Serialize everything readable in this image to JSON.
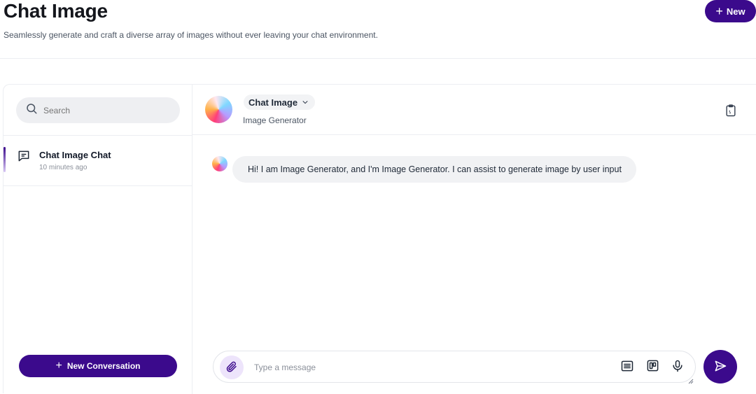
{
  "header": {
    "title": "Chat Image",
    "subtitle": "Seamlessly generate and craft a diverse array of images without ever leaving your chat environment.",
    "new_button": "New"
  },
  "sidebar": {
    "search_placeholder": "Search",
    "conversations": [
      {
        "title": "Chat Image Chat",
        "time": "10 minutes ago"
      }
    ],
    "new_conversation_button": "New Conversation"
  },
  "chat": {
    "model_name": "Chat Image",
    "model_subtitle": "Image Generator",
    "messages": [
      {
        "role": "bot",
        "text": "Hi! I am Image Generator, and I'm Image Generator. I can assist to generate image by user input"
      }
    ],
    "input_placeholder": "Type a message"
  },
  "colors": {
    "accent": "#3b0a8c",
    "attach_bg": "#ede4fb",
    "bubble_bg": "#f1f2f4",
    "search_bg": "#eeeff2"
  },
  "icons": {
    "new": "plus-icon",
    "search": "search-icon",
    "conversation": "chat-bubble-icon",
    "model_dropdown": "chevron-down-icon",
    "header_action": "clipboard-icon",
    "attach": "paperclip-icon",
    "prompt_list": "list-icon",
    "templates": "board-icon",
    "voice": "microphone-icon",
    "send": "send-icon"
  }
}
